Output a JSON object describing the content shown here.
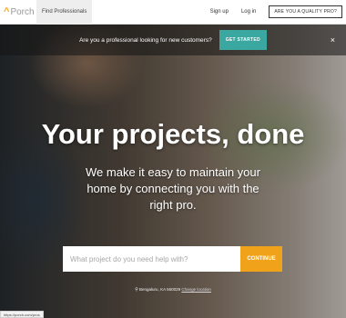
{
  "header": {
    "logo_mark": "^",
    "logo_text": "Porch",
    "find_professionals": "Find Professionals",
    "sign_up": "Sign up",
    "log_in": "Log in",
    "pro_button": "ARE YOU A QUALITY PRO?"
  },
  "promo": {
    "text": "Are you a professional looking for new customers?",
    "cta": "GET STARTED",
    "close": "×"
  },
  "hero": {
    "headline": "Your projects, done",
    "subline": "We make it easy to maintain your home by connecting you with the right pro."
  },
  "search": {
    "placeholder": "What project do you need help with?",
    "value": "",
    "continue_label": "CONTINUE"
  },
  "location": {
    "icon": "⚲",
    "text": "Bengaluru, KA 560029",
    "change_label": "Change location"
  },
  "status": {
    "url": "https://porch.com/pros"
  },
  "colors": {
    "accent_orange": "#f0a21b",
    "teal": "#3aa7a0",
    "logo_orange": "#f5a623"
  }
}
